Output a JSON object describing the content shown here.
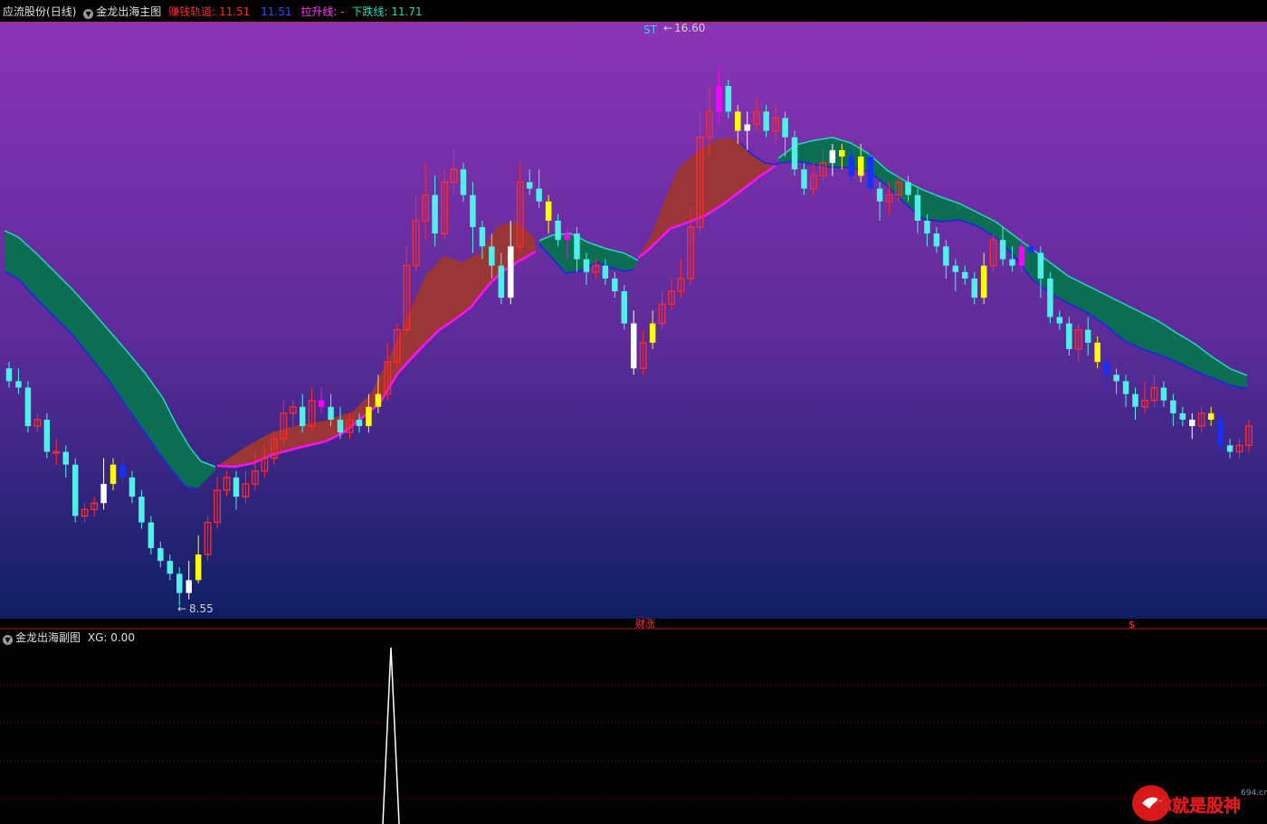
{
  "header": {
    "stock_name": "应流股份",
    "period": "(日线)",
    "indicator_name": "金龙出海主图",
    "earn_channel_label": "赚钱轨道:",
    "earn_channel_value": "11.51",
    "earn_channel_value2": "11.51",
    "pull_up_label": "拉升线:",
    "pull_up_value": "-",
    "fall_label": "下跌线:",
    "fall_value": "11.71"
  },
  "sub_header": {
    "indicator_name": "金龙出海副图",
    "xg_label": "XG:",
    "xg_value": "0.00"
  },
  "markers": {
    "high_label": "16.60",
    "low_label": "8.55",
    "st_label": "ST",
    "arrow": "←",
    "caizhang_label": "财涨",
    "dollar_label": "$"
  },
  "watermark": {
    "text": "你就是股神",
    "site": "694.cn"
  },
  "colors": {
    "up_candle": "#ff2a2a",
    "down_candle": "#4ff0e8",
    "yellow_candle": "#ffff00",
    "white_candle": "#ffffff",
    "magenta_candle": "#ff00ff",
    "blue_candle": "#1530ff",
    "green_band": "#0b6e52",
    "red_band": "#9a3636",
    "magenta_line": "#ff10ff",
    "blue_line": "#1a2bd6",
    "cyan_line": "#20d8c0",
    "bg_top": "#8a34b4",
    "bg_bottom": "#0e1f64"
  },
  "chart_data": {
    "type": "candlestick",
    "price_range": [
      8.0,
      17.3
    ],
    "high": 16.6,
    "low": 8.55,
    "series": [
      {
        "values": [
          [
            11.9,
            11.7,
            12.0,
            11.6
          ],
          [
            11.7,
            11.6,
            11.9,
            11.5
          ],
          [
            11.6,
            11.0,
            11.7,
            10.9
          ],
          [
            11.0,
            11.1,
            11.2,
            10.9
          ],
          [
            11.1,
            10.6,
            11.2,
            10.5
          ],
          [
            10.6,
            10.6,
            10.8,
            10.4
          ],
          [
            10.6,
            10.4,
            10.7,
            10.2
          ],
          [
            10.4,
            9.6,
            10.5,
            9.5
          ],
          [
            9.6,
            9.7,
            9.8,
            9.5
          ],
          [
            9.7,
            9.8,
            9.9,
            9.6
          ],
          [
            9.8,
            10.1,
            10.5,
            9.7
          ],
          [
            10.1,
            10.4,
            10.5,
            10.0
          ],
          [
            10.4,
            10.2,
            10.5,
            10.1
          ],
          [
            10.2,
            9.9,
            10.3,
            9.8
          ],
          [
            9.9,
            9.5,
            10.0,
            9.4
          ],
          [
            9.5,
            9.1,
            9.6,
            9.0
          ],
          [
            9.1,
            8.9,
            9.2,
            8.8
          ],
          [
            8.9,
            8.7,
            9.0,
            8.6
          ],
          [
            8.7,
            8.4,
            8.8,
            8.2
          ],
          [
            8.4,
            8.6,
            8.9,
            8.3
          ],
          [
            8.6,
            9.0,
            9.3,
            8.55
          ],
          [
            9.0,
            9.5,
            9.6,
            8.9
          ],
          [
            9.5,
            10.0,
            10.2,
            9.4
          ],
          [
            10.0,
            10.2,
            10.3,
            9.9
          ],
          [
            10.2,
            9.9,
            10.3,
            9.7
          ],
          [
            9.9,
            10.1,
            10.3,
            9.8
          ],
          [
            10.1,
            10.3,
            10.6,
            10.0
          ],
          [
            10.3,
            10.5,
            10.7,
            10.2
          ],
          [
            10.5,
            10.8,
            10.9,
            10.4
          ],
          [
            10.8,
            11.2,
            11.4,
            10.7
          ],
          [
            11.2,
            11.3,
            11.4,
            11.0
          ],
          [
            11.3,
            11.0,
            11.5,
            10.9
          ],
          [
            11.0,
            11.4,
            11.6,
            10.9
          ],
          [
            11.4,
            11.3,
            11.6,
            11.2
          ],
          [
            11.3,
            11.1,
            11.5,
            11.0
          ],
          [
            11.1,
            10.9,
            11.3,
            10.8
          ],
          [
            10.9,
            11.1,
            11.2,
            10.8
          ],
          [
            11.1,
            11.0,
            11.2,
            10.9
          ],
          [
            11.0,
            11.3,
            11.5,
            10.9
          ],
          [
            11.3,
            11.5,
            11.8,
            11.2
          ],
          [
            11.5,
            12.0,
            12.3,
            11.4
          ],
          [
            12.0,
            12.5,
            12.6,
            11.9
          ],
          [
            12.5,
            13.5,
            13.8,
            12.4
          ],
          [
            13.5,
            14.2,
            14.6,
            13.4
          ],
          [
            14.2,
            14.6,
            15.1,
            13.9
          ],
          [
            14.6,
            14.0,
            14.9,
            13.8
          ],
          [
            14.0,
            14.8,
            15.0,
            13.9
          ],
          [
            14.8,
            15.0,
            15.3,
            14.6
          ],
          [
            15.0,
            14.6,
            15.1,
            14.5
          ],
          [
            14.6,
            14.1,
            14.8,
            13.7
          ],
          [
            14.1,
            13.8,
            14.2,
            13.6
          ],
          [
            13.8,
            13.5,
            14.0,
            13.3
          ],
          [
            13.5,
            13.0,
            13.7,
            12.9
          ],
          [
            13.0,
            13.8,
            14.2,
            12.9
          ],
          [
            13.8,
            14.8,
            15.1,
            13.7
          ],
          [
            14.8,
            14.7,
            15.0,
            14.6
          ],
          [
            14.7,
            14.5,
            15.0,
            14.4
          ],
          [
            14.5,
            14.2,
            14.6,
            14.0
          ],
          [
            14.2,
            13.9,
            14.3,
            13.8
          ],
          [
            13.9,
            14.0,
            14.1,
            13.6
          ],
          [
            14.0,
            13.6,
            14.1,
            13.4
          ],
          [
            13.6,
            13.4,
            13.7,
            13.2
          ],
          [
            13.4,
            13.5,
            13.6,
            13.3
          ],
          [
            13.5,
            13.3,
            13.6,
            13.2
          ],
          [
            13.3,
            13.1,
            13.4,
            13.0
          ],
          [
            13.1,
            12.6,
            13.2,
            12.5
          ],
          [
            12.6,
            11.9,
            12.8,
            11.8
          ],
          [
            11.9,
            12.3,
            12.5,
            11.8
          ],
          [
            12.3,
            12.6,
            12.8,
            12.2
          ],
          [
            12.6,
            12.9,
            13.1,
            12.5
          ],
          [
            12.9,
            13.1,
            13.3,
            12.8
          ],
          [
            13.1,
            13.3,
            13.6,
            13.0
          ],
          [
            13.3,
            14.1,
            14.4,
            13.2
          ],
          [
            14.1,
            15.5,
            15.9,
            14.0
          ],
          [
            15.5,
            15.9,
            16.3,
            15.2
          ],
          [
            15.9,
            16.3,
            16.6,
            15.7
          ],
          [
            16.3,
            15.9,
            16.4,
            15.8
          ],
          [
            15.9,
            15.6,
            16.0,
            15.4
          ],
          [
            15.6,
            15.7,
            15.9,
            15.3
          ],
          [
            15.7,
            15.9,
            16.1,
            15.6
          ],
          [
            15.9,
            15.6,
            16.0,
            15.5
          ],
          [
            15.6,
            15.8,
            16.0,
            15.4
          ],
          [
            15.8,
            15.5,
            15.9,
            15.2
          ],
          [
            15.5,
            15.0,
            15.6,
            14.9
          ],
          [
            15.0,
            14.7,
            15.1,
            14.6
          ],
          [
            14.7,
            14.9,
            15.1,
            14.6
          ],
          [
            14.9,
            15.1,
            15.3,
            14.8
          ],
          [
            15.1,
            15.3,
            15.4,
            14.9
          ],
          [
            15.3,
            15.2,
            15.4,
            15.0
          ],
          [
            15.2,
            14.9,
            15.3,
            14.8
          ],
          [
            14.9,
            15.2,
            15.4,
            14.8
          ],
          [
            15.2,
            14.7,
            15.3,
            14.6
          ],
          [
            14.7,
            14.5,
            14.8,
            14.2
          ],
          [
            14.5,
            14.6,
            14.8,
            14.3
          ],
          [
            14.6,
            14.8,
            14.9,
            14.5
          ],
          [
            14.8,
            14.6,
            14.9,
            14.5
          ],
          [
            14.6,
            14.2,
            14.7,
            14.0
          ],
          [
            14.2,
            14.0,
            14.3,
            13.8
          ],
          [
            14.0,
            13.8,
            14.1,
            13.7
          ],
          [
            13.8,
            13.5,
            13.9,
            13.3
          ],
          [
            13.5,
            13.4,
            13.6,
            13.1
          ],
          [
            13.4,
            13.3,
            13.5,
            13.2
          ],
          [
            13.3,
            13.0,
            13.4,
            12.9
          ],
          [
            13.0,
            13.5,
            13.7,
            12.9
          ],
          [
            13.5,
            13.9,
            14.0,
            13.4
          ],
          [
            13.9,
            13.6,
            14.1,
            13.5
          ],
          [
            13.6,
            13.5,
            13.8,
            13.4
          ],
          [
            13.5,
            13.8,
            14.0,
            13.4
          ],
          [
            13.8,
            13.7,
            13.9,
            13.4
          ],
          [
            13.7,
            13.3,
            13.8,
            13.0
          ],
          [
            13.3,
            12.7,
            13.4,
            12.6
          ],
          [
            12.7,
            12.6,
            12.8,
            12.5
          ],
          [
            12.6,
            12.2,
            12.7,
            12.1
          ],
          [
            12.2,
            12.5,
            12.6,
            12.0
          ],
          [
            12.5,
            12.3,
            12.7,
            12.1
          ],
          [
            12.3,
            12.0,
            12.4,
            11.9
          ],
          [
            12.0,
            11.8,
            12.1,
            11.5
          ],
          [
            11.8,
            11.7,
            11.9,
            11.5
          ],
          [
            11.7,
            11.5,
            11.8,
            11.3
          ],
          [
            11.5,
            11.3,
            11.6,
            11.1
          ],
          [
            11.3,
            11.4,
            11.7,
            11.2
          ],
          [
            11.4,
            11.6,
            11.8,
            11.3
          ],
          [
            11.6,
            11.4,
            11.7,
            11.3
          ],
          [
            11.4,
            11.2,
            11.5,
            11.0
          ],
          [
            11.2,
            11.1,
            11.3,
            11.0
          ],
          [
            11.1,
            11.0,
            11.2,
            10.8
          ],
          [
            11.0,
            11.2,
            11.3,
            10.9
          ],
          [
            11.2,
            11.1,
            11.3,
            11.0
          ],
          [
            11.1,
            10.7,
            11.2,
            10.6
          ],
          [
            10.7,
            10.6,
            10.8,
            10.5
          ],
          [
            10.6,
            10.7,
            10.8,
            10.5
          ],
          [
            10.7,
            11.0,
            11.1,
            10.6
          ]
        ]
      }
    ],
    "xg_signal": 0.0
  }
}
